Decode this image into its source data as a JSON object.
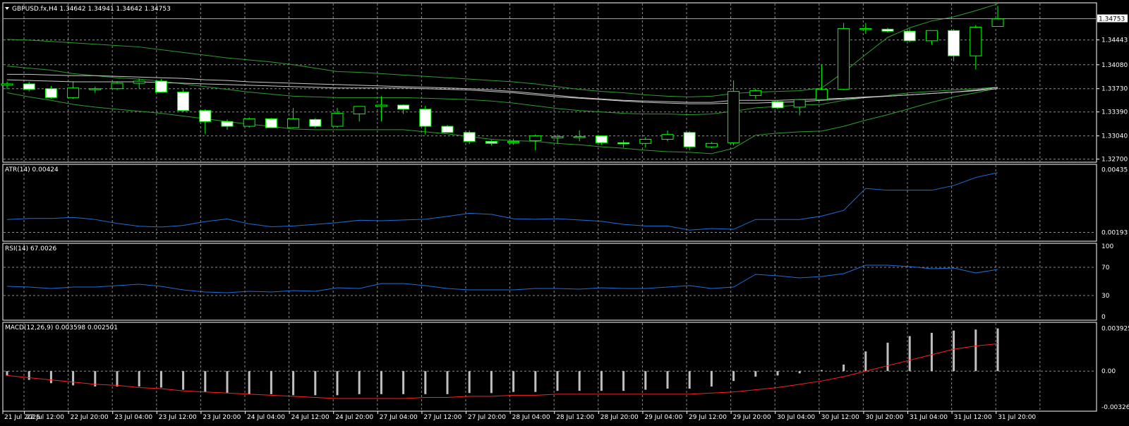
{
  "chart_data": {
    "type": "candlestick",
    "symbol_header": "GBPUSD.fx,H4  1.34642 1.34941 1.34642 1.34753",
    "current_price": 1.34753,
    "current_price_label": "1.34753",
    "price_ticks": [
      "1.34443",
      "1.34080",
      "1.33730",
      "1.33390",
      "1.33040",
      "1.32700"
    ],
    "price_tick_values": [
      1.34443,
      1.3408,
      1.3373,
      1.3339,
      1.3304,
      1.327
    ],
    "time_labels": [
      "21 Jul 2026",
      "22 Jul 12:00",
      "22 Jul 20:00",
      "23 Jul 04:00",
      "23 Jul 12:00",
      "23 Jul 20:00",
      "24 Jul 04:00",
      "24 Jul 12:00",
      "24 Jul 20:00",
      "27 Jul 04:00",
      "27 Jul 12:00",
      "27 Jul 20:00",
      "28 Jul 04:00",
      "28 Jul 12:00",
      "28 Jul 20:00",
      "29 Jul 04:00",
      "29 Jul 12:00",
      "29 Jul 20:00",
      "30 Jul 04:00",
      "30 Jul 12:00",
      "30 Jul 20:00",
      "31 Jul 04:00",
      "31 Jul 12:00",
      "31 Jul 20:00"
    ],
    "candles": [
      {
        "o": 1.3378,
        "h": 1.3383,
        "l": 1.3372,
        "c": 1.338
      },
      {
        "o": 1.338,
        "h": 1.3383,
        "l": 1.3369,
        "c": 1.3372
      },
      {
        "o": 1.3373,
        "h": 1.3377,
        "l": 1.3358,
        "c": 1.336
      },
      {
        "o": 1.336,
        "h": 1.3384,
        "l": 1.3358,
        "c": 1.3374
      },
      {
        "o": 1.3373,
        "h": 1.3376,
        "l": 1.3367,
        "c": 1.3373
      },
      {
        "o": 1.3373,
        "h": 1.3384,
        "l": 1.3371,
        "c": 1.3381
      },
      {
        "o": 1.3381,
        "h": 1.3388,
        "l": 1.3373,
        "c": 1.3384
      },
      {
        "o": 1.3384,
        "h": 1.3387,
        "l": 1.3369,
        "c": 1.3368
      },
      {
        "o": 1.3368,
        "h": 1.3372,
        "l": 1.3339,
        "c": 1.3341
      },
      {
        "o": 1.3341,
        "h": 1.3343,
        "l": 1.3307,
        "c": 1.3325
      },
      {
        "o": 1.3325,
        "h": 1.3328,
        "l": 1.3313,
        "c": 1.3318
      },
      {
        "o": 1.3318,
        "h": 1.3331,
        "l": 1.3316,
        "c": 1.3329
      },
      {
        "o": 1.3329,
        "h": 1.333,
        "l": 1.3316,
        "c": 1.3316
      },
      {
        "o": 1.3316,
        "h": 1.3345,
        "l": 1.3315,
        "c": 1.3329
      },
      {
        "o": 1.3328,
        "h": 1.333,
        "l": 1.3316,
        "c": 1.3318
      },
      {
        "o": 1.3318,
        "h": 1.3345,
        "l": 1.3316,
        "c": 1.3337
      },
      {
        "o": 1.3336,
        "h": 1.3344,
        "l": 1.3325,
        "c": 1.3347
      },
      {
        "o": 1.3347,
        "h": 1.3362,
        "l": 1.3325,
        "c": 1.3349
      },
      {
        "o": 1.3349,
        "h": 1.335,
        "l": 1.3336,
        "c": 1.3343
      },
      {
        "o": 1.3343,
        "h": 1.3348,
        "l": 1.3306,
        "c": 1.3318
      },
      {
        "o": 1.3318,
        "h": 1.332,
        "l": 1.3311,
        "c": 1.3309
      },
      {
        "o": 1.3309,
        "h": 1.3312,
        "l": 1.3292,
        "c": 1.3296
      },
      {
        "o": 1.3296,
        "h": 1.3298,
        "l": 1.329,
        "c": 1.3293
      },
      {
        "o": 1.3294,
        "h": 1.33,
        "l": 1.3291,
        "c": 1.3296
      },
      {
        "o": 1.3297,
        "h": 1.3306,
        "l": 1.3283,
        "c": 1.3304
      },
      {
        "o": 1.3301,
        "h": 1.3306,
        "l": 1.3293,
        "c": 1.3303
      },
      {
        "o": 1.3303,
        "h": 1.3312,
        "l": 1.3296,
        "c": 1.3303
      },
      {
        "o": 1.3304,
        "h": 1.3304,
        "l": 1.3291,
        "c": 1.3294
      },
      {
        "o": 1.3294,
        "h": 1.3298,
        "l": 1.3287,
        "c": 1.3293
      },
      {
        "o": 1.3293,
        "h": 1.3302,
        "l": 1.3287,
        "c": 1.3299
      },
      {
        "o": 1.3299,
        "h": 1.3312,
        "l": 1.3296,
        "c": 1.3306
      },
      {
        "o": 1.3309,
        "h": 1.3311,
        "l": 1.3283,
        "c": 1.3288
      },
      {
        "o": 1.3288,
        "h": 1.3295,
        "l": 1.3286,
        "c": 1.3293
      },
      {
        "o": 1.3294,
        "h": 1.3385,
        "l": 1.329,
        "c": 1.3369
      },
      {
        "o": 1.3363,
        "h": 1.3373,
        "l": 1.3358,
        "c": 1.337
      },
      {
        "o": 1.3354,
        "h": 1.3356,
        "l": 1.3343,
        "c": 1.3345
      },
      {
        "o": 1.3346,
        "h": 1.3358,
        "l": 1.3334,
        "c": 1.3357
      },
      {
        "o": 1.3357,
        "h": 1.3408,
        "l": 1.3356,
        "c": 1.3372
      },
      {
        "o": 1.3372,
        "h": 1.3469,
        "l": 1.3371,
        "c": 1.3461
      },
      {
        "o": 1.3461,
        "h": 1.3469,
        "l": 1.3453,
        "c": 1.3461
      },
      {
        "o": 1.346,
        "h": 1.3462,
        "l": 1.3455,
        "c": 1.3457
      },
      {
        "o": 1.3457,
        "h": 1.3461,
        "l": 1.3441,
        "c": 1.3443
      },
      {
        "o": 1.3443,
        "h": 1.3457,
        "l": 1.3437,
        "c": 1.3458
      },
      {
        "o": 1.3458,
        "h": 1.346,
        "l": 1.3413,
        "c": 1.3421
      },
      {
        "o": 1.3421,
        "h": 1.3466,
        "l": 1.3401,
        "c": 1.3463
      },
      {
        "o": 1.3464,
        "h": 1.3494,
        "l": 1.3464,
        "c": 1.3475
      }
    ],
    "indicators": {
      "atr": {
        "label": "ATR(14) 0.00424",
        "ticks": [
          "0.00435",
          "0.00193"
        ],
        "tick_values": [
          0.00435,
          0.00193
        ],
        "values": [
          0.00243,
          0.00247,
          0.00247,
          0.00251,
          0.00243,
          0.00228,
          0.00217,
          0.00214,
          0.0022,
          0.00235,
          0.00245,
          0.00226,
          0.00215,
          0.00218,
          0.00224,
          0.00231,
          0.0024,
          0.00238,
          0.00241,
          0.00244,
          0.00255,
          0.00267,
          0.00263,
          0.00246,
          0.00244,
          0.00246,
          0.00241,
          0.00236,
          0.00224,
          0.00218,
          0.00218,
          0.00202,
          0.00208,
          0.00205,
          0.00243,
          0.00243,
          0.00243,
          0.00256,
          0.00278,
          0.00363,
          0.00356,
          0.00356,
          0.00356,
          0.00374,
          0.00405,
          0.00424
        ]
      },
      "rsi": {
        "label": "RSI(14) 67.0026",
        "ticks": [
          "100",
          "70",
          "30",
          "0"
        ],
        "tick_values": [
          100,
          70,
          30,
          0
        ],
        "values": [
          43,
          42,
          40,
          42,
          42,
          44,
          46,
          43,
          38,
          35,
          34,
          36,
          35,
          37,
          36,
          41,
          40,
          47,
          47,
          44,
          40,
          38,
          38,
          38,
          40,
          40,
          39,
          41,
          40,
          40,
          42,
          44,
          40,
          42,
          60,
          58,
          55,
          57,
          61,
          73,
          73,
          71,
          68,
          69,
          62,
          67
        ]
      },
      "macd": {
        "label": "MACD(12,26,9) 0.003598 0.002501",
        "ticks": [
          "0.003925",
          "0.00",
          "-0.00326"
        ],
        "tick_values": [
          0.003925,
          0,
          -0.00326
        ],
        "histogram": [
          -0.0004,
          -0.0008,
          -0.0011,
          -0.0013,
          -0.0014,
          -0.0014,
          -0.0014,
          -0.0015,
          -0.0017,
          -0.0019,
          -0.002,
          -0.0021,
          -0.0021,
          -0.0022,
          -0.0022,
          -0.0022,
          -0.0021,
          -0.0021,
          -0.0021,
          -0.0021,
          -0.0021,
          -0.002,
          -0.002,
          -0.0019,
          -0.0019,
          -0.0018,
          -0.0018,
          -0.0018,
          -0.0018,
          -0.0017,
          -0.0016,
          -0.0016,
          -0.0014,
          -0.0009,
          -0.0005,
          -0.0004,
          -0.0002,
          0.0001,
          0.0006,
          0.0018,
          0.0026,
          0.0032,
          0.0035,
          0.0037,
          0.0038,
          0.0039
        ],
        "signal": [
          -0.0004,
          -0.0006,
          -0.0008,
          -0.001,
          -0.0012,
          -0.0013,
          -0.0015,
          -0.0016,
          -0.0018,
          -0.0019,
          -0.002,
          -0.0021,
          -0.0022,
          -0.0023,
          -0.0024,
          -0.0025,
          -0.0025,
          -0.0025,
          -0.0025,
          -0.0024,
          -0.0024,
          -0.0023,
          -0.0023,
          -0.0022,
          -0.0022,
          -0.0021,
          -0.0021,
          -0.0021,
          -0.0021,
          -0.0021,
          -0.0021,
          -0.0021,
          -0.002,
          -0.0019,
          -0.0017,
          -0.0015,
          -0.0012,
          -0.0009,
          -0.0005,
          0.0,
          0.0005,
          0.001,
          0.0015,
          0.002,
          0.0023,
          0.0025
        ]
      }
    },
    "overlays": {
      "bollinger_upper": [
        1.3445,
        1.3444,
        1.3442,
        1.344,
        1.3438,
        1.3436,
        1.3434,
        1.343,
        1.3426,
        1.3422,
        1.3418,
        1.3415,
        1.3412,
        1.3408,
        1.3403,
        1.3398,
        1.3397,
        1.3395,
        1.3393,
        1.3391,
        1.3389,
        1.3387,
        1.3385,
        1.3383,
        1.338,
        1.3376,
        1.3372,
        1.3369,
        1.3367,
        1.3364,
        1.3362,
        1.3361,
        1.3362,
        1.3366,
        1.3368,
        1.3369,
        1.337,
        1.3374,
        1.3397,
        1.3423,
        1.3448,
        1.3462,
        1.3472,
        1.3478,
        1.3487,
        1.3497
      ],
      "bollinger_lower": [
        1.3367,
        1.3361,
        1.3356,
        1.335,
        1.3346,
        1.3343,
        1.334,
        1.3337,
        1.3333,
        1.3329,
        1.3325,
        1.3321,
        1.3318,
        1.3314,
        1.3313,
        1.3313,
        1.3313,
        1.3313,
        1.3313,
        1.331,
        1.3307,
        1.3303,
        1.3299,
        1.3297,
        1.3296,
        1.3293,
        1.3291,
        1.3288,
        1.3286,
        1.3283,
        1.3281,
        1.328,
        1.3278,
        1.3286,
        1.3305,
        1.3308,
        1.331,
        1.3311,
        1.3318,
        1.3327,
        1.3335,
        1.3344,
        1.3353,
        1.3361,
        1.3367,
        1.3374
      ],
      "bollinger_mid": [
        1.3406,
        1.3403,
        1.34,
        1.3395,
        1.3392,
        1.3389,
        1.3387,
        1.3384,
        1.338,
        1.3376,
        1.3372,
        1.3368,
        1.3365,
        1.3362,
        1.3361,
        1.336,
        1.336,
        1.336,
        1.336,
        1.3359,
        1.3358,
        1.3357,
        1.3355,
        1.3352,
        1.3348,
        1.3344,
        1.3341,
        1.3339,
        1.3337,
        1.3336,
        1.3336,
        1.3335,
        1.3336,
        1.334,
        1.3345,
        1.3347,
        1.3349,
        1.335,
        1.3356,
        1.336,
        1.3363,
        1.3367,
        1.3369,
        1.3371,
        1.3373,
        1.3375
      ],
      "ma_slow_1": [
        1.3394,
        1.3394,
        1.3393,
        1.3392,
        1.3392,
        1.3391,
        1.339,
        1.3389,
        1.3388,
        1.3386,
        1.3385,
        1.3383,
        1.3382,
        1.3381,
        1.338,
        1.3379,
        1.3378,
        1.3377,
        1.3376,
        1.3375,
        1.3374,
        1.3373,
        1.3371,
        1.3369,
        1.3366,
        1.3363,
        1.336,
        1.3358,
        1.3356,
        1.3355,
        1.3354,
        1.3353,
        1.3353,
        1.3356,
        1.3356,
        1.3356,
        1.3357,
        1.3358,
        1.3359,
        1.3361,
        1.3362,
        1.3364,
        1.3366,
        1.3368,
        1.337,
        1.3373
      ],
      "ma_slow_2": [
        1.3386,
        1.3385,
        1.3384,
        1.3383,
        1.3383,
        1.3383,
        1.3383,
        1.3382,
        1.3381,
        1.338,
        1.3379,
        1.3378,
        1.3377,
        1.3376,
        1.3375,
        1.3374,
        1.3374,
        1.3374,
        1.3374,
        1.3373,
        1.3372,
        1.3371,
        1.3369,
        1.3367,
        1.3364,
        1.3361,
        1.3359,
        1.3357,
        1.3355,
        1.3353,
        1.3352,
        1.3351,
        1.3351,
        1.3352,
        1.3352,
        1.3353,
        1.3354,
        1.3356,
        1.3358,
        1.336,
        1.3362,
        1.3364,
        1.3366,
        1.3368,
        1.3371,
        1.3375
      ]
    },
    "colors": {
      "background": "#000000",
      "grid": "#8a8a8a",
      "axis_text": "#ffffff",
      "bull_body": "#000000",
      "bear_body": "#ffffff",
      "candle_border": "#00ff00",
      "bollinger": "#2e9e2e",
      "ma_line": "#c8c8c8",
      "atr_line": "#1e6fd9",
      "rsi_line": "#1e6fd9",
      "macd_hist": "#c0c0c0",
      "macd_signal": "#ff2020",
      "pane_border": "#ffffff"
    }
  }
}
